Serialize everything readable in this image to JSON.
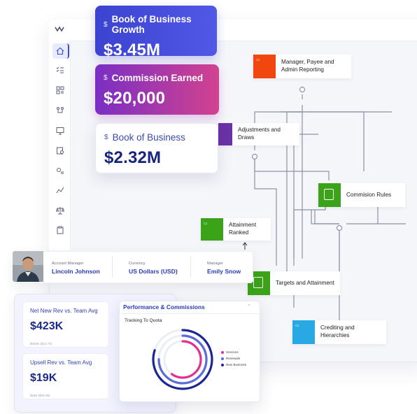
{
  "kpis": {
    "book_growth": {
      "currency_symbol": "$",
      "title": "Book of Business Growth",
      "value": "$3.45M"
    },
    "commission": {
      "currency_symbol": "$",
      "title": "Commission Earned",
      "value": "$20,000"
    },
    "book": {
      "currency_symbol": "$",
      "title": "Book of Business",
      "value": "$2.32M"
    }
  },
  "sidebar": {
    "icons": [
      "home-icon",
      "checklist-icon",
      "grid-icon",
      "org-icon",
      "monitor-icon",
      "calendar-clock-icon",
      "settings-list-icon",
      "chart-line-icon",
      "scale-icon",
      "clipboard-icon"
    ]
  },
  "flow": {
    "nodes": {
      "reporting": {
        "label": "Manager, Payee and Admin Reporting",
        "color": "#f2460f"
      },
      "adjustments": {
        "label": "Adjustments and Draws",
        "color": "#6a32a6"
      },
      "rules": {
        "label": "Commision Rules",
        "color": "#3aa317"
      },
      "ranked": {
        "label": "Attainment Ranked",
        "color": "#3aa317"
      },
      "targets": {
        "label": "Targets and Attainment",
        "color": "#3aa317"
      },
      "crediting": {
        "label": "Crediting and Hierarchies",
        "color": "#29a9e3"
      }
    }
  },
  "profile": {
    "account_manager": {
      "label": "Account Manager",
      "value": "Lincoln Johnson"
    },
    "currency": {
      "label": "Currency",
      "value": "US Dollars (USD)"
    },
    "manager": {
      "label": "Manager",
      "value": "Emily Snow"
    }
  },
  "stats": {
    "new_rev": {
      "title": "Net New Rev vs. Team Avg",
      "value": "$423K",
      "sub": "$404K ($14.75)"
    },
    "upsell": {
      "title": "Upsell Rev vs. Team Avg",
      "value": "$19K",
      "sub": "$18K ($28.35)"
    }
  },
  "performance": {
    "title": "Performance & Commissions",
    "collapse_glyph": "⌃",
    "subtitle": "Tracking To Quota",
    "legend": [
      {
        "label": "Services",
        "color": "#e0318e"
      },
      {
        "label": "Renewals",
        "color": "#5b6bd9"
      },
      {
        "label": "New Business",
        "color": "#1a2596"
      }
    ]
  },
  "chart_data": {
    "type": "radial-bar",
    "title": "Tracking To Quota",
    "series": [
      {
        "name": "New Business",
        "value": 0.8,
        "color": "#1a2596"
      },
      {
        "name": "Renewals",
        "value": 0.75,
        "color": "#5b6bd9"
      },
      {
        "name": "Services",
        "value": 0.6,
        "color": "#e0318e"
      }
    ]
  }
}
